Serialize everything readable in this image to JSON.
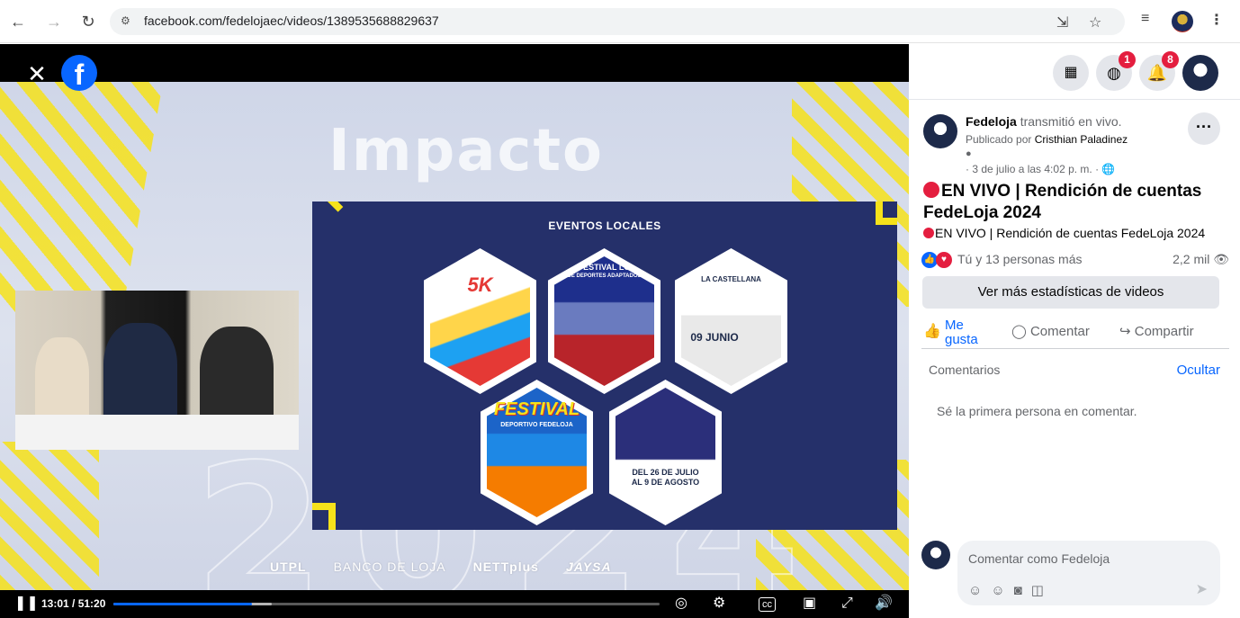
{
  "browser": {
    "back_icon": "arrow-left-icon",
    "url": "facebook.com/fedelojaec/videos/1389535688829637",
    "badge_messenger": "1",
    "badge_notifications": "8"
  },
  "video": {
    "slide_title": "EVENTOS LOCALES",
    "impacto_text": "Impacto",
    "year_text": "2024",
    "events": [
      {
        "label": "5K",
        "sub": ""
      },
      {
        "label": "FESTIVAL LO",
        "sub": "DE DEPORTES ADAPTADOS"
      },
      {
        "label": "LA CASTELLANA",
        "sub": "09 JUNIO"
      },
      {
        "label": "FESTIVAL",
        "sub": "DEPORTIVO FEDELOJA"
      },
      {
        "label": "DEL 26 DE JULIO",
        "sub": "AL 9 DE AGOSTO"
      }
    ],
    "sponsors": [
      "UTPL",
      "BANCO DE LOJA",
      "NETTplus",
      "JAYSA"
    ],
    "time": "13:01 / 51:20",
    "progress": 0.253,
    "buffered": 0.29
  },
  "post": {
    "page_name": "Fedeloja",
    "action_text": "transmitió en vivo.",
    "published_by_prefix": "Publicado por",
    "published_by": "Cristhian Paladinez",
    "date": "· 3 de julio a las 4:02 p. m. ·",
    "title": "EN VIVO | Rendición de cuentas FedeLoja 2024",
    "description": "EN VIVO | Rendición de cuentas FedeLoja 2024",
    "reactions_text": "Tú y 13 personas más",
    "views": "2,2 mil",
    "stats_button": "Ver más estadísticas de videos",
    "like_label": "Me gusta",
    "comment_label": "Comentar",
    "share_label": "Compartir",
    "comments_label": "Comentarios",
    "hide_label": "Ocultar",
    "first_comment": "Sé la primera persona en comentar.",
    "compose_placeholder": "Comentar como Fedeloja"
  },
  "colors": {
    "brand_blue": "#0866ff",
    "live_red": "#e41e3f",
    "slide_navy": "#25306a",
    "accent_yellow": "#f6e21a"
  }
}
